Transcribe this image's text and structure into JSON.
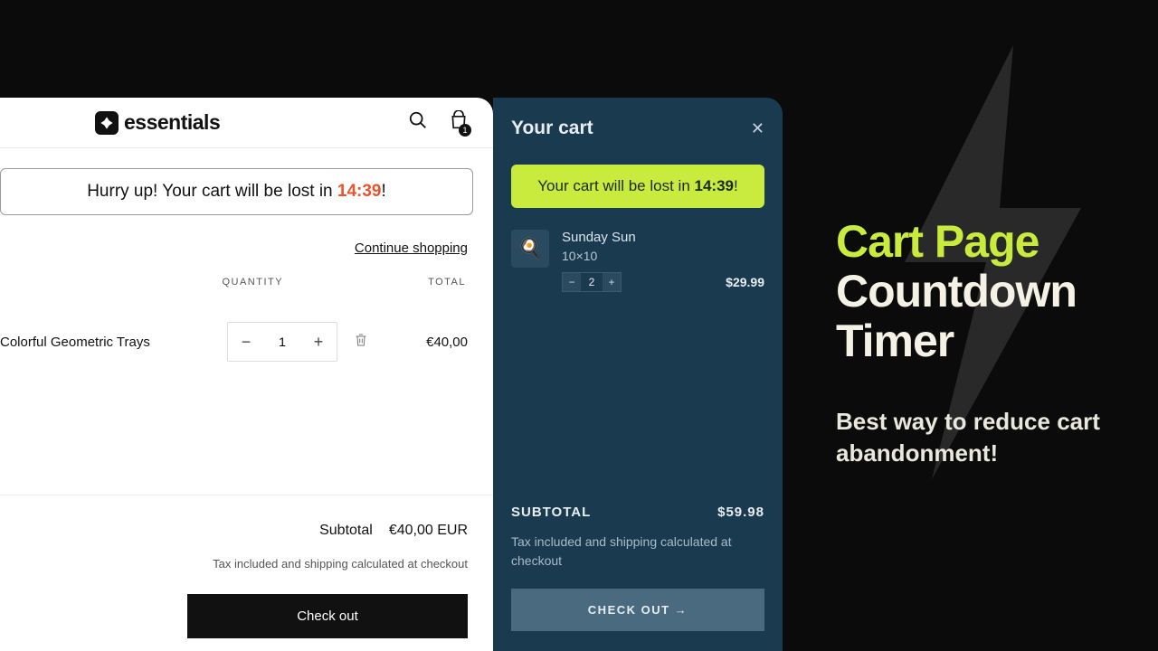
{
  "cartPage": {
    "logo": "essentials",
    "bagCount": "1",
    "banner": {
      "prefix": "Hurry up! Your cart will be lost in ",
      "timer": "14:39",
      "suffix": "!"
    },
    "continueLink": "Continue shopping",
    "cols": {
      "qty": "QUANTITY",
      "total": "TOTAL"
    },
    "product": {
      "name": "Colorful Geometric Trays",
      "qty": "1",
      "total": "€40,00"
    },
    "subtotal": {
      "label": "Subtotal",
      "value": "€40,00 EUR"
    },
    "taxNote": "Tax included and shipping calculated at checkout",
    "checkout": "Check out"
  },
  "drawer": {
    "title": "Your cart",
    "banner": {
      "prefix": "Your cart will be lost in ",
      "timer": "14:39",
      "suffix": "!"
    },
    "item": {
      "name": "Sunday Sun",
      "variant": "10×10",
      "qty": "2",
      "price": "$29.99"
    },
    "subtotal": {
      "label": "SUBTOTAL",
      "value": "$59.98"
    },
    "taxNote": "Tax included and shipping calculated at checkout",
    "checkout": "CHECK OUT →"
  },
  "marketing": {
    "line1": "Cart Page",
    "line2": "Countdown Timer",
    "sub": "Best way to reduce cart abandonment!"
  }
}
